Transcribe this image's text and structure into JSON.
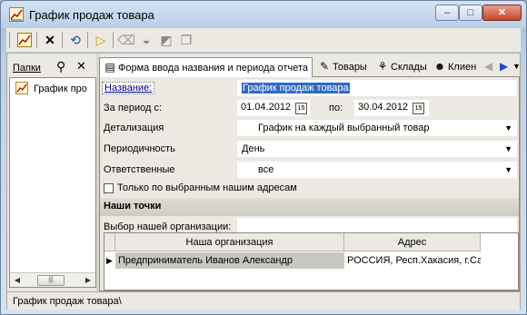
{
  "window": {
    "title": "График продаж товара",
    "buttons": {
      "minimize": "–",
      "maximize": "□",
      "close": "✕"
    }
  },
  "toolbar": {
    "icons": [
      "chart-icon",
      "delete-icon",
      "refresh-icon",
      "open-folder-icon",
      "eraser-icon",
      "filter-icon",
      "filter-off-icon",
      "copy-icon"
    ]
  },
  "left_panel": {
    "label": "Папки",
    "tree": [
      {
        "label": "График про"
      }
    ]
  },
  "tabs": [
    {
      "label": "Форма ввода названия и периода отчета",
      "active": true
    },
    {
      "label": "Товары"
    },
    {
      "label": "Склады"
    },
    {
      "label": "Клиен"
    }
  ],
  "form": {
    "name_label": "Название:",
    "name_value": "График продаж товара",
    "period_label": "За период с:",
    "date_from": "01.04.2012",
    "to_label": "по:",
    "date_to": "30.04.2012",
    "detail_label": "Детализация",
    "detail_value": "График на каждый выбранный товар",
    "period_type_label": "Периодичность",
    "period_type_value": "День",
    "responsible_label": "Ответственные",
    "responsible_value": "все",
    "checkbox_label": "Только по выбранным нашим адресам",
    "section_title": "Наши точки",
    "org_select_label": "Выбор нашей организации:",
    "org_select_value": ""
  },
  "grid": {
    "columns": [
      "Наша организация",
      "Адрес"
    ],
    "rows": [
      [
        "Предприниматель Иванов Александр",
        "РОССИЯ, Респ.Хакасия, г.Са"
      ]
    ]
  },
  "status": {
    "text": "График продаж товара\\"
  },
  "colors": {
    "selection": "#316ac5",
    "panel": "#ece9e2",
    "titlebar": "#b8cfe8"
  }
}
